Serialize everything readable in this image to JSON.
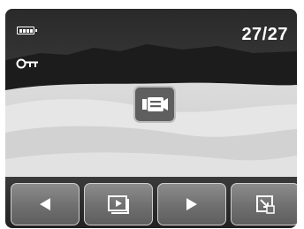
{
  "status": {
    "battery_icon": "battery-full-icon",
    "protect_icon": "key-lock-icon",
    "counter": "27/27"
  },
  "badge": {
    "icon": "movie-camera-icon"
  },
  "toolbar": {
    "buttons": [
      {
        "icon": "triangle-left-icon"
      },
      {
        "icon": "slideshow-icon"
      },
      {
        "icon": "triangle-right-icon"
      },
      {
        "icon": "zoom-resize-icon"
      }
    ]
  },
  "colors": {
    "overlay_text": "#ffffff",
    "button_face": "#7a7a7a",
    "button_border": "#cfcfcf"
  }
}
